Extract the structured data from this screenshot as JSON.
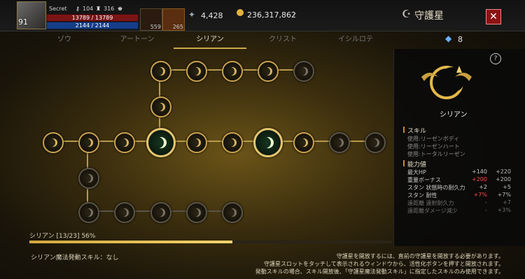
{
  "player": {
    "level": "91",
    "hp": "13789 / 13789",
    "mp": "2144 / 2144",
    "stat_badge": "Secret",
    "stat_a": "104",
    "stat_b": "316"
  },
  "slots": [
    {
      "icon": "potion-icon",
      "count": "559"
    },
    {
      "icon": "flask-icon",
      "count": "265"
    }
  ],
  "currency": {
    "gems": "4,428",
    "gold": "236,317,862"
  },
  "window": {
    "title": "守護星"
  },
  "tabs": [
    "ゾウ",
    "アートーン",
    "シリアン",
    "クリスト",
    "イシルロテ"
  ],
  "active_tab": 2,
  "crystal_count": "8",
  "progress": {
    "label": "シリアン [13/23]  56%",
    "fraction": 0.56
  },
  "panel": {
    "name": "シリアン",
    "skills_header": "スキル",
    "skills": [
      "使用:リーゼンボディ",
      "使用:リーゼンハート",
      "使用:トータルリーゼン"
    ],
    "stats_header": "能力値",
    "stats": [
      {
        "name": "最大HP",
        "a": "+140",
        "b": "+220",
        "dim": false,
        "a_red": false
      },
      {
        "name": "重量ボーナス",
        "a": "+200",
        "b": "+200",
        "dim": false,
        "a_red": true
      },
      {
        "name": "スタン 状態時の耐久力",
        "a": "+2",
        "b": "+5",
        "dim": false,
        "a_red": false
      },
      {
        "name": "スタン 耐性",
        "a": "+7%",
        "b": "+7%",
        "dim": false,
        "a_red": true
      },
      {
        "name": "遠距離 遠射耐久力",
        "a": "-",
        "b": "+7",
        "dim": true,
        "a_red": false
      },
      {
        "name": "遠距離ダメージ減少",
        "a": "-",
        "b": "+3%",
        "dim": true,
        "a_red": false
      }
    ]
  },
  "bottom": {
    "left": "シリアン魔法発動スキル：なし",
    "right": [
      "守護星を開放するには、直前の守護星を開放する必要があります。",
      "守護星スロットをタッチして表示されるウィンドウから、活性化ボタンを押すと開放されます。",
      "発動スキルの場合、スキル開放後、「守護星魔法発動スキル」に指定したスキルのみ使用できます。"
    ]
  },
  "colors": {
    "accent": "#caa24e",
    "active_node": "#e5c670",
    "close": "#8a1414"
  }
}
